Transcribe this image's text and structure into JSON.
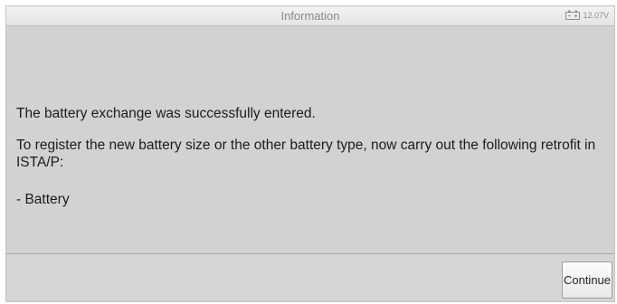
{
  "window": {
    "title": "Information"
  },
  "status": {
    "battery_icon": "battery-icon",
    "voltage": "12.07V"
  },
  "message": {
    "line1": "The battery exchange was successfully entered.",
    "line2": "To register the new battery size or the other battery type, now carry out the following retrofit in ISTA/P:",
    "line3": "- Battery"
  },
  "footer": {
    "continue_label": "Continue"
  },
  "colors": {
    "background": "#d3d3d3",
    "titlebar": "#ececec",
    "text": "#1c1c1c"
  }
}
